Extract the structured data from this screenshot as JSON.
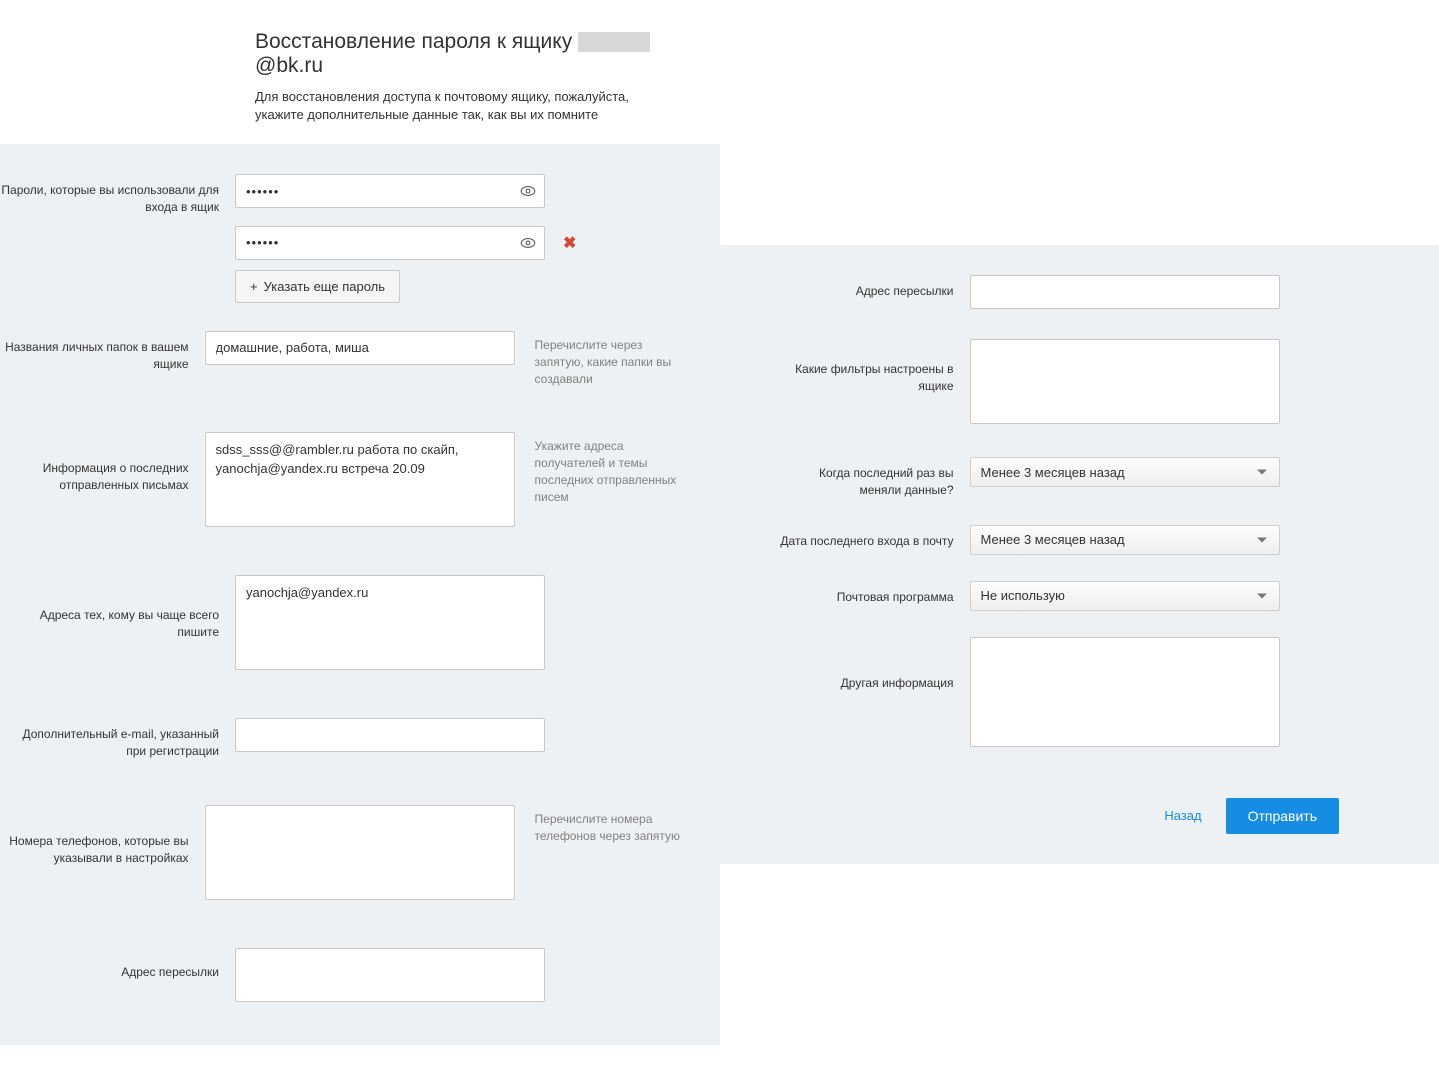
{
  "header": {
    "title_prefix": "Восстановление пароля к ящику ",
    "title_suffix": "@bk.ru",
    "subtitle": "Для восстановления доступа к почтовому ящику, пожалуйста, укажите дополнительные данные так, как вы их помните"
  },
  "left": {
    "passwords_label": "Пароли, которые вы использовали для входа в ящик",
    "password1": "••••••",
    "password2": "••••••",
    "add_password_button": "Указать еще пароль",
    "folders_label": "Названия личных папок в вашем ящике",
    "folders_value": "домашние, работа, миша",
    "folders_hint": "Перечислите через запятую, какие папки вы создавали",
    "last_sent_label": "Информация о последних отправленных письмах",
    "last_sent_value": "sdss_sss@@rambler.ru работа по скайп, yanochja@yandex.ru встреча 20.09",
    "last_sent_hint": "Укажите адреса получателей и темы последних отправленных писем",
    "frequent_label": "Адреса тех, кому вы чаще всего пишите",
    "frequent_value": "yanochja@yandex.ru",
    "extra_email_label": "Дополнительный e-mail, указанный при регистрации",
    "extra_email_value": "",
    "phones_label": "Номера телефонов, которые вы указывали в настройках",
    "phones_value": "",
    "phones_hint": "Перечислите номера телефонов через запятую",
    "forward_label": "Адрес пересылки",
    "forward_value": ""
  },
  "right": {
    "forward_label": "Адрес пересылки",
    "forward_value": "",
    "filters_label": "Какие фильтры настроены в ящике",
    "filters_value": "",
    "last_change_label": "Когда последний раз вы меняли данные?",
    "last_change_value": "Менее 3 месяцев назад",
    "last_login_label": "Дата последнего входа в почту",
    "last_login_value": "Менее 3 месяцев назад",
    "client_label": "Почтовая программа",
    "client_value": "Не использую",
    "other_label": "Другая информация",
    "other_value": "",
    "back_link": "Назад",
    "submit_button": "Отправить"
  }
}
